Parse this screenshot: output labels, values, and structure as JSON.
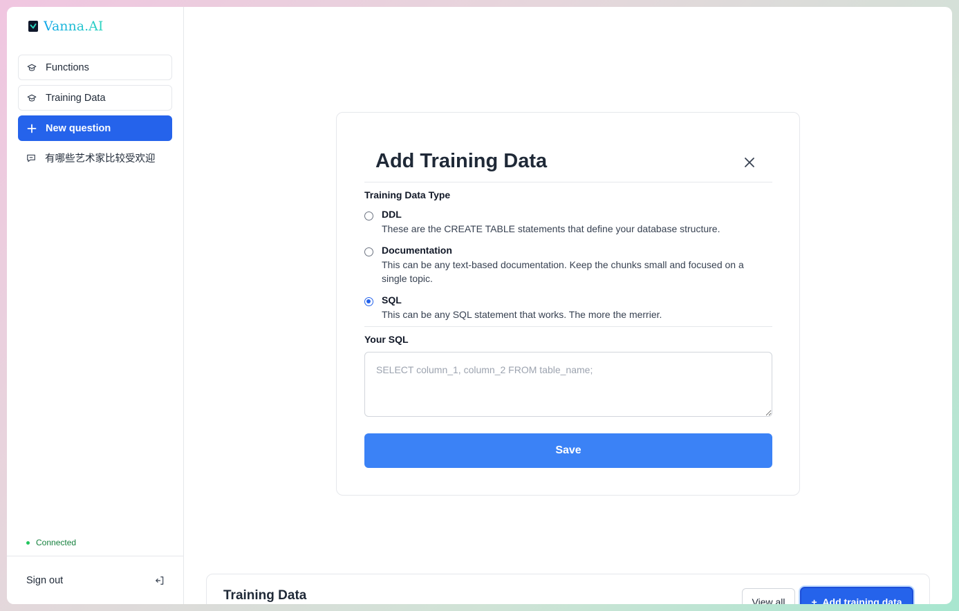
{
  "brand": {
    "name": "Vanna.AI",
    "logo_icon": "check-square-icon"
  },
  "sidebar": {
    "items": [
      {
        "label": "Functions",
        "icon": "graduation-cap-icon"
      },
      {
        "label": "Training Data",
        "icon": "graduation-cap-icon"
      },
      {
        "label": "New question",
        "icon": "plus-icon"
      },
      {
        "label": "有哪些艺术家比较受欢迎",
        "icon": "chat-bubble-icon"
      }
    ],
    "status": "Connected",
    "signout_label": "Sign out"
  },
  "modal": {
    "title": "Add Training Data",
    "type_label": "Training Data Type",
    "options": [
      {
        "title": "DDL",
        "description": "These are the CREATE TABLE statements that define your database structure.",
        "selected": false
      },
      {
        "title": "Documentation",
        "description": "This can be any text-based documentation. Keep the chunks small and focused on a single topic.",
        "selected": false
      },
      {
        "title": "SQL",
        "description": "This can be any SQL statement that works. The more the merrier.",
        "selected": true
      }
    ],
    "input_label": "Your SQL",
    "input_value": "",
    "input_placeholder": "SELECT column_1, column_2 FROM table_name;",
    "save_label": "Save"
  },
  "training_card": {
    "title": "Training Data",
    "view_all_label": "View all",
    "add_label": "Add training data"
  },
  "colors": {
    "primary": "#2563eb",
    "save": "#3b82f6",
    "status": "#15803d"
  }
}
